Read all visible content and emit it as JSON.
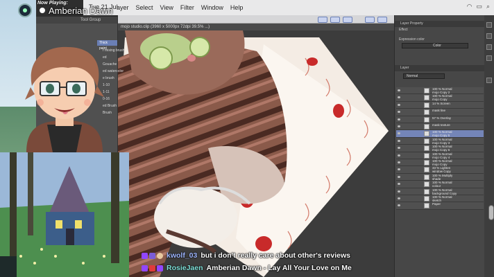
{
  "menubar": {
    "clock": "Tue 21 Jul",
    "items": [
      "ayer",
      "Select",
      "View",
      "Filter",
      "Window",
      "Help"
    ]
  },
  "doc_tab": "mojo studio.clip (3960 x 5000px 72dpi 39.5% ...)",
  "now_playing": {
    "label": "Now Playing:",
    "title": "Amberian Dawn"
  },
  "tool_panel": {
    "header": "Tool Group",
    "active_tab": "Thick paint",
    "brushes": [
      "r mixing brush",
      "ed",
      "Gouache",
      "ed watercolor",
      "e brush",
      "1-10",
      "1-11",
      "0-16",
      "ed Brush",
      "Brush"
    ]
  },
  "right_panel": {
    "layer_property_header": "Layer Property",
    "effect_label": "Effect",
    "expression_label": "Expression color",
    "expression_value": "Color",
    "layer_header": "Layer",
    "blend_mode": "Normal",
    "layers": [
      {
        "line1": "100 % Normal",
        "line2": "mojo Copy 2"
      },
      {
        "line1": "100 % Normal",
        "line2": "mojo Copy"
      },
      {
        "line1": "14 % Screen",
        "line2": ""
      },
      {
        "line1": "mask line",
        "line2": ""
      },
      {
        "line1": "57 % Overlay",
        "line2": ""
      },
      {
        "line1": "mask texture",
        "line2": ""
      },
      {
        "line1": "100 % Normal",
        "line2": "mojo Copy 5"
      },
      {
        "line1": "100 % Normal",
        "line2": "mojo Copy 3"
      },
      {
        "line1": "100 % Normal",
        "line2": "mojo Copy 6"
      },
      {
        "line1": "100 % Normal",
        "line2": "mojo Copy 4"
      },
      {
        "line1": "100 % Normal",
        "line2": "mojo Copy"
      },
      {
        "line1": "33 % Lighten",
        "line2": "window Copy"
      },
      {
        "line1": "100 % Multiply",
        "line2": "shade"
      },
      {
        "line1": "100 % Normal",
        "line2": "colour"
      },
      {
        "line1": "100 % Normal",
        "line2": "background Copy"
      },
      {
        "line1": "100 % Normal",
        "line2": "sketch"
      },
      {
        "line1": "Paper",
        "line2": ""
      }
    ]
  },
  "chat": {
    "messages": [
      {
        "user": "kwolf_03",
        "user_color": "#9fb7ff",
        "text": "but i don't really care about other's reviews"
      },
      {
        "user": "RosieJaen",
        "user_color": "#7fe0d8",
        "text": "Amberian Dawn - Lay All Your Love on Me"
      }
    ]
  }
}
